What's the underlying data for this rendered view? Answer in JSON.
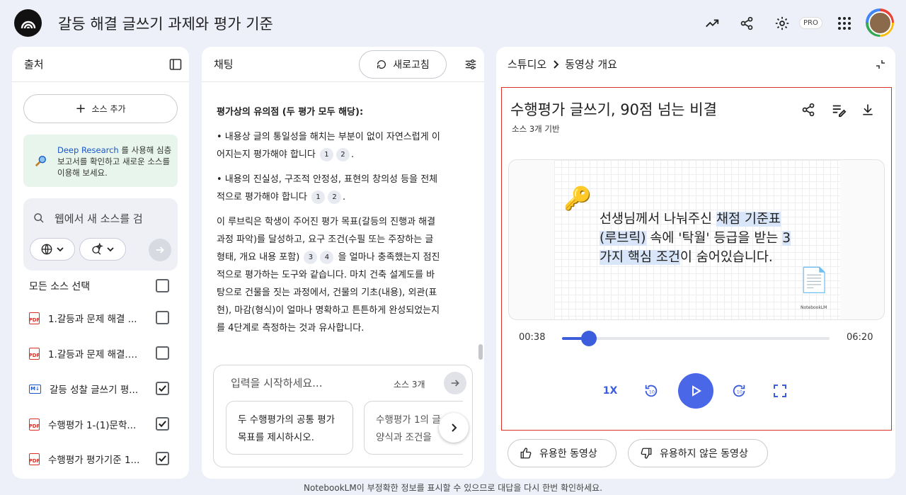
{
  "app": {
    "title": "갈등 해결 글쓰기 과제와 평가 기준",
    "pro_badge": "PRO"
  },
  "sources": {
    "header": "출처",
    "add_label": "소스 추가",
    "deep_research": {
      "link": "Deep Research",
      "text": " 를 사용해 심층 보고서를 확인하고 새로운 소스를 이용해 보세요."
    },
    "search_placeholder": "웹에서 새 소스를 검",
    "select_all": "모든 소스 선택",
    "items": [
      {
        "name": "1.갈등과 문제 해결 ...",
        "type": "pdf",
        "checked": false
      },
      {
        "name": "1.갈등과 문제 해결.p...",
        "type": "pdf",
        "checked": false
      },
      {
        "name": "갈등 성찰 글쓰기 평...",
        "type": "md",
        "checked": true
      },
      {
        "name": "수행평가 1-(1)문학...",
        "type": "pdf",
        "checked": true
      },
      {
        "name": "수행평가 평가기준 1...",
        "type": "pdf",
        "checked": true
      }
    ]
  },
  "chat": {
    "header": "채팅",
    "refresh": "새로고침",
    "heading": "평가상의 유의점 (두 평가 모두 해당):",
    "p1": "• 내용상 글의 통일성을 해치는 부분이 없이 자연스럽게 이어지는지 평가해야 합니다",
    "p1_cites": [
      "1",
      "2"
    ],
    "p2": "• 내용의 진실성, 구조적 안정성, 표현의 창의성 등을 전체적으로 평가해야 합니다",
    "p2_cites": [
      "1",
      "2"
    ],
    "p3a": "이 루브릭은 학생이 주어진 평가 목표(갈등의 진행과 해결 과정 파악)를 달성하고, 요구 조건(수필 또는 주장하는 글 형태, 개요 내용 포함)",
    "p3_cites": [
      "3",
      "4"
    ],
    "p3b": " 을 얼마나 충족했는지 점진적으로 평가하는 도구와 같습니다. 마치 건축 설계도를 바탕으로 건물을 짓는 과정에서, 건물의 기초(내용), 외관(표현), 마감(형식)이 얼마나 명확하고 튼튼하게 완성되었는지를 4단계로 측정하는 것과 유사합니다.",
    "input_placeholder": "입력을 시작하세요...",
    "source_count": "소스 3개",
    "suggestions": [
      "두 수행평가의 공통 평가 목표를 제시하시오.",
      "수행평가 1의 글 양식과 조건을"
    ]
  },
  "studio": {
    "crumb_root": "스튜디오",
    "crumb_leaf": "동영상 개요",
    "video_title": "수행평가 글쓰기, 90점 넘는 비결",
    "video_sub": "소스 3개 기반",
    "slide": {
      "t1": "선생님께서 나눠주신 ",
      "h1": "채점 기준표",
      "h2": "(루브릭)",
      "t2": " 속에 '탁월' 등급을 받는 ",
      "h3": "3가지 핵심 조건",
      "t3": "이 숨어있습니다.",
      "watermark": "NotebookLM"
    },
    "current_time": "00:38",
    "duration": "06:20",
    "progress": 0.1,
    "speed": "1X",
    "like": "유용한 동영상",
    "dislike": "유용하지 않은 동영상"
  },
  "footer": "NotebookLM이 부정확한 정보를 표시할 수 있으므로 대답을 다시 한번 확인하세요."
}
